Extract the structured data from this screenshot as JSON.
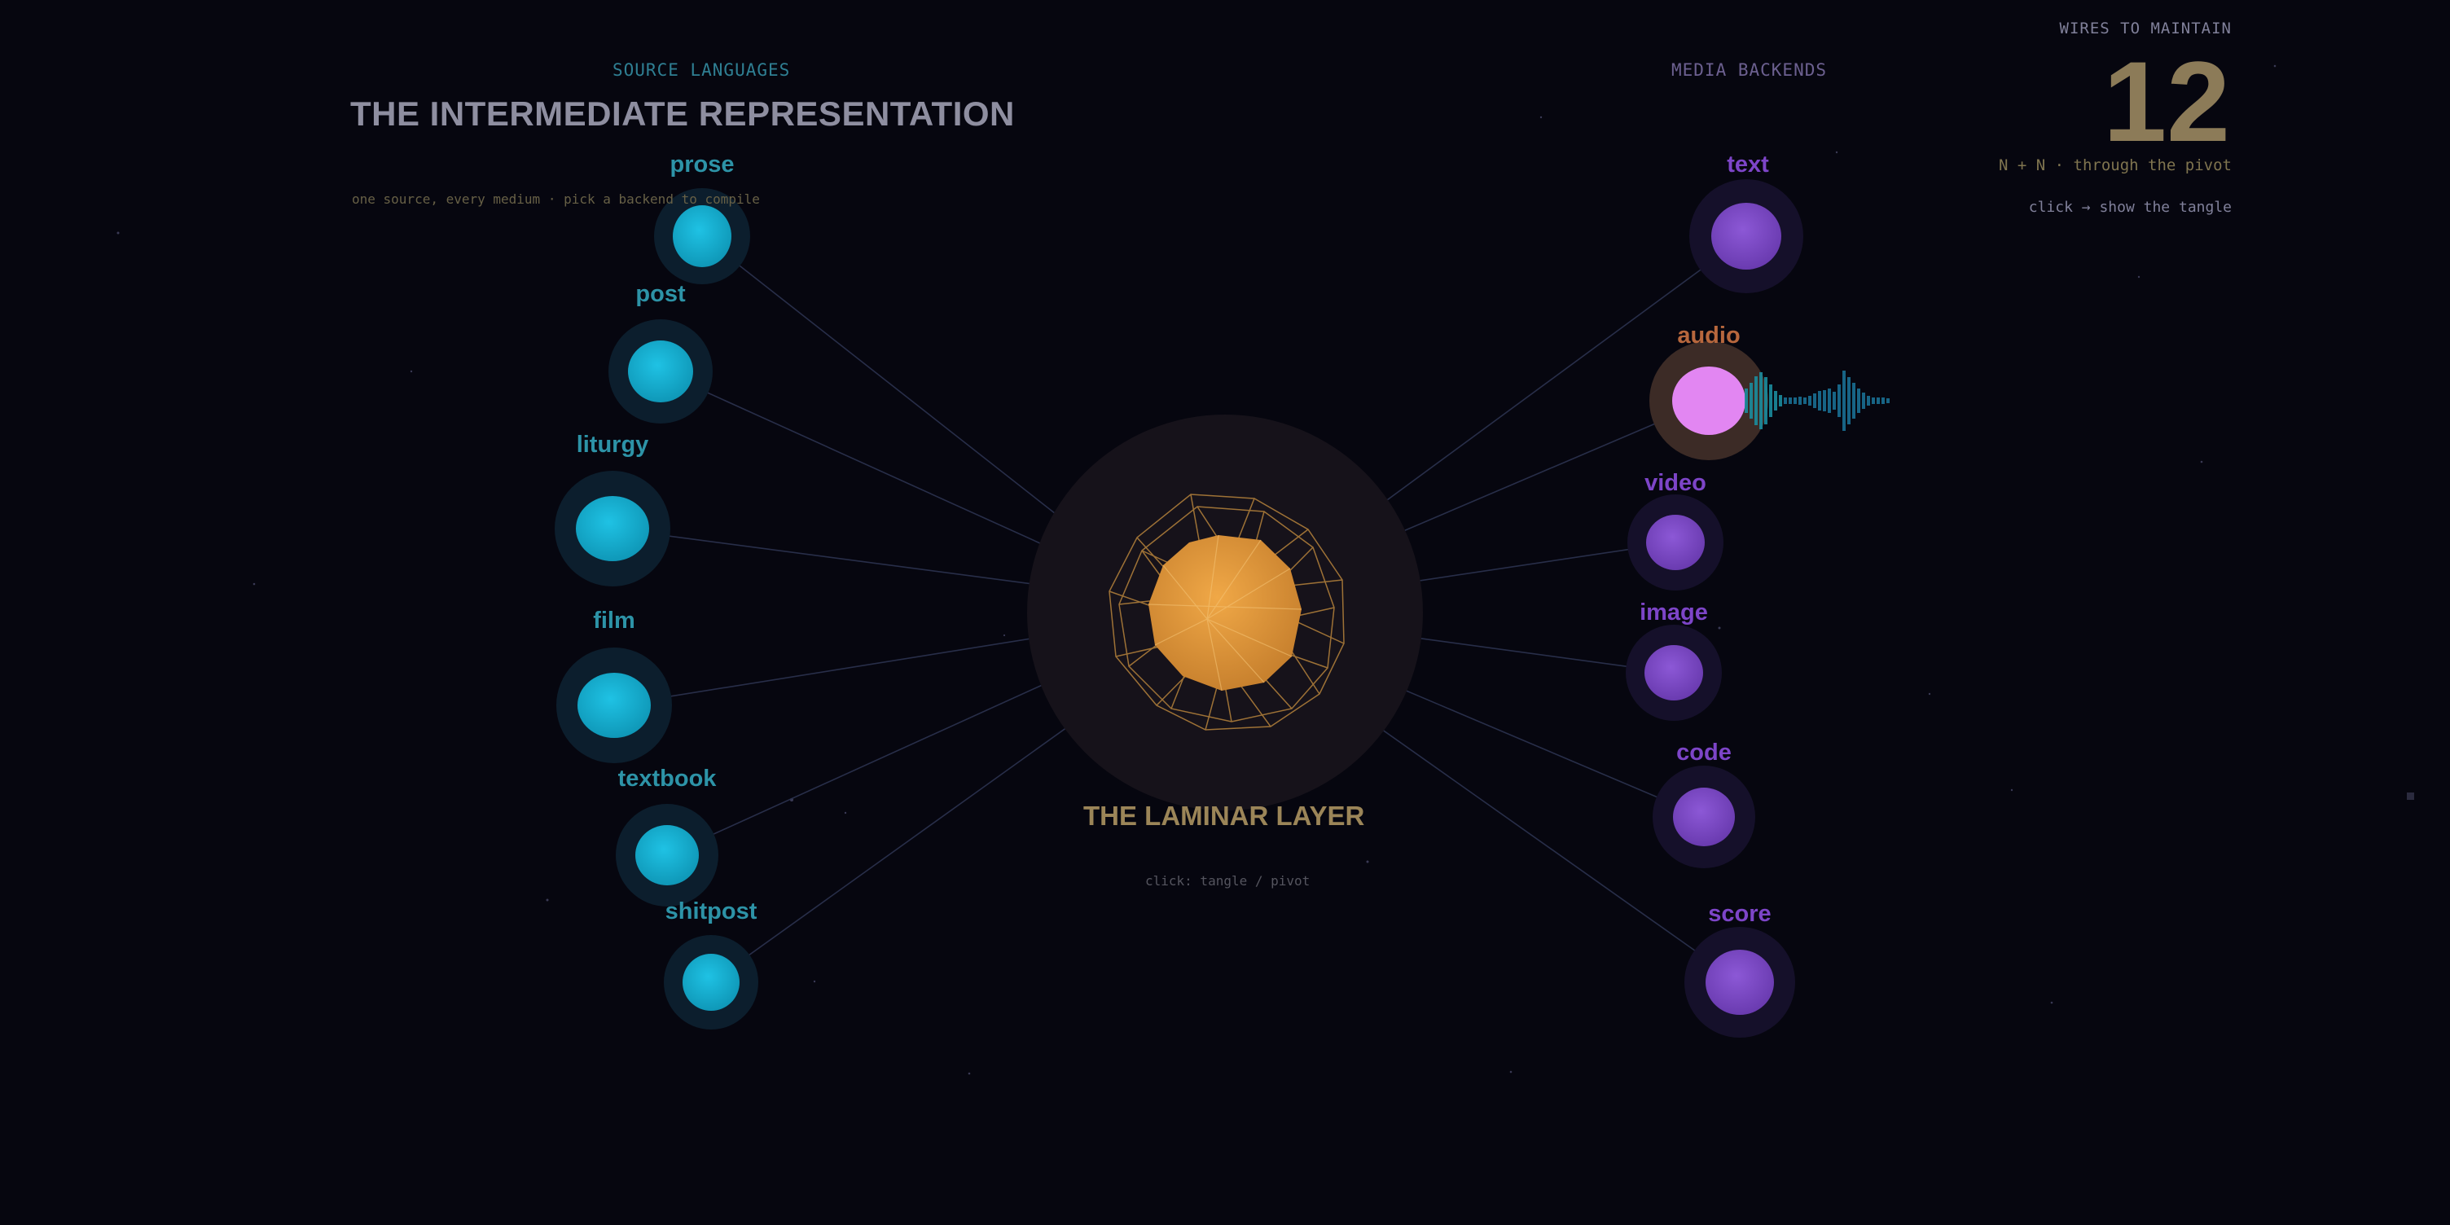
{
  "header": {
    "sources_heading": "SOURCE LANGUAGES",
    "backends_heading": "MEDIA BACKENDS",
    "title": "THE INTERMEDIATE REPRESENTATION",
    "subtitle": "one source, every medium · pick a backend to compile"
  },
  "counter": {
    "label": "WIRES TO MAINTAIN",
    "value": "12",
    "formula": "N + N · through the pivot",
    "hint": "click → show the tangle"
  },
  "pivot": {
    "title": "THE LAMINAR LAYER",
    "hint": "click: tangle / pivot"
  },
  "sources": [
    {
      "label": "prose"
    },
    {
      "label": "post"
    },
    {
      "label": "liturgy"
    },
    {
      "label": "film"
    },
    {
      "label": "textbook"
    },
    {
      "label": "shitpost"
    }
  ],
  "backends": [
    {
      "label": "text",
      "selected": false
    },
    {
      "label": "audio",
      "selected": true
    },
    {
      "label": "video",
      "selected": false
    },
    {
      "label": "image",
      "selected": false
    },
    {
      "label": "code",
      "selected": false
    },
    {
      "label": "score",
      "selected": false
    }
  ],
  "colors": {
    "background": "#06060f",
    "source_node": "#17b4d8",
    "backend_node": "#7c4bc4",
    "selected_backend": "#e286f2",
    "pivot": "#e09a3c",
    "waveform": "#1a7f9a"
  }
}
